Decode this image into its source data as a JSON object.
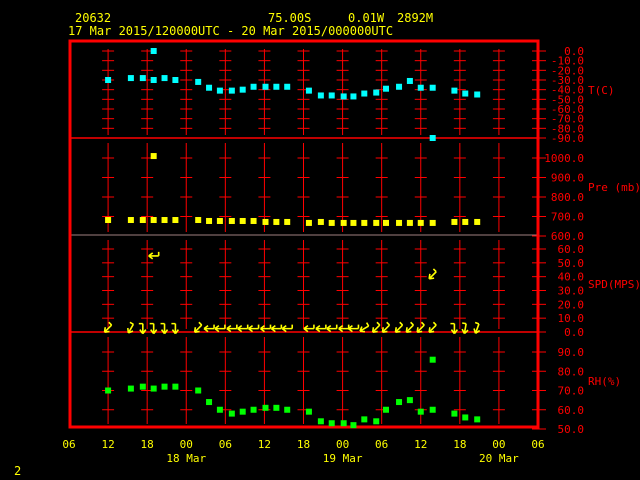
{
  "header": {
    "station_id": "20632",
    "latitude": "75.00S",
    "longitude": "0.01W",
    "elevation": "2892M",
    "period": "17 Mar 2015/120000UTC - 20 Mar 2015/000000UTC"
  },
  "page_number": "2",
  "colors": {
    "frame": "#ff0000",
    "text": "#ffff00",
    "temperature": "#00ffff",
    "pressure": "#ffff00",
    "wind": "#ffff00",
    "humidity": "#00ff00"
  },
  "chart_data": {
    "type": "scatter",
    "grid": true,
    "x_ticks": [
      {
        "time": "2015-03-17 06:00",
        "label": "06"
      },
      {
        "time": "2015-03-17 12:00",
        "label": "12"
      },
      {
        "time": "2015-03-17 18:00",
        "label": "18"
      },
      {
        "time": "2015-03-18 00:00",
        "label": "00"
      },
      {
        "time": "2015-03-18 06:00",
        "label": "06"
      },
      {
        "time": "2015-03-18 12:00",
        "label": "12"
      },
      {
        "time": "2015-03-18 18:00",
        "label": "18"
      },
      {
        "time": "2015-03-19 00:00",
        "label": "00"
      },
      {
        "time": "2015-03-19 06:00",
        "label": "06"
      },
      {
        "time": "2015-03-19 12:00",
        "label": "12"
      },
      {
        "time": "2015-03-19 18:00",
        "label": "18"
      },
      {
        "time": "2015-03-20 00:00",
        "label": "00"
      },
      {
        "time": "2015-03-20 06:00",
        "label": "06"
      }
    ],
    "date_labels": [
      {
        "time": "2015-03-18 00:00",
        "label": "18 Mar"
      },
      {
        "time": "2015-03-19 00:00",
        "label": "19 Mar"
      },
      {
        "time": "2015-03-20 00:00",
        "label": "20 Mar"
      }
    ],
    "xlim": [
      "2015-03-17 06:00",
      "2015-03-20 06:00"
    ],
    "times": [
      "2015-03-17 12:00",
      "2015-03-17 15:30",
      "2015-03-17 17:20",
      "2015-03-17 19:00",
      "2015-03-17 20:40",
      "2015-03-17 22:20",
      "2015-03-18 01:50",
      "2015-03-18 03:30",
      "2015-03-18 05:10",
      "2015-03-18 07:00",
      "2015-03-18 08:40",
      "2015-03-18 10:20",
      "2015-03-18 12:10",
      "2015-03-18 13:50",
      "2015-03-18 15:30",
      "2015-03-18 18:50",
      "2015-03-18 20:40",
      "2015-03-18 22:20",
      "2015-03-19 00:10",
      "2015-03-19 01:40",
      "2015-03-19 03:20",
      "2015-03-19 05:10",
      "2015-03-19 06:40",
      "2015-03-19 08:40",
      "2015-03-19 10:20",
      "2015-03-19 12:00",
      "2015-03-19 13:50",
      "2015-03-19 17:10",
      "2015-03-19 18:50",
      "2015-03-19 20:40"
    ],
    "panels": [
      {
        "key": "temperature",
        "label": "T(C)",
        "ylim": [
          -90,
          0
        ],
        "y_ticks": [
          "0.0",
          "-10.0",
          "-20.0",
          "-30.0",
          "-40.0",
          "-50.0",
          "-60.0",
          "-70.0",
          "-80.0",
          "-90.0"
        ],
        "y_tick_values": [
          0,
          -10,
          -20,
          -30,
          -40,
          -50,
          -60,
          -70,
          -80,
          -90
        ],
        "values": [
          -30,
          -28,
          -28,
          -30,
          -28,
          -30,
          -32,
          -38,
          -41,
          -41,
          -40,
          -37,
          -37,
          -37,
          -37,
          -41,
          -46,
          -46,
          -47,
          -47,
          -44,
          -43,
          -39,
          -37,
          -31,
          -38,
          -38,
          -41,
          -44,
          -45
        ],
        "extra_points": [
          {
            "time": "2015-03-17 19:00",
            "value": 0
          },
          {
            "time": "2015-03-19 13:50",
            "value": -90
          }
        ]
      },
      {
        "key": "pressure",
        "label": "Pre (mb)",
        "ylim": [
          600,
          1000
        ],
        "y_ticks": [
          "1000.0",
          "900.0",
          "800.0",
          "700.0",
          "600.0"
        ],
        "y_tick_values": [
          1000,
          900,
          800,
          700,
          600
        ],
        "values": [
          682,
          682,
          682,
          682,
          682,
          682,
          682,
          677,
          677,
          677,
          677,
          677,
          672,
          672,
          672,
          667,
          672,
          667,
          667,
          667,
          667,
          667,
          667,
          667,
          667,
          667,
          667,
          672,
          672,
          672
        ],
        "extra_points": [
          {
            "time": "2015-03-17 19:00",
            "value": 1010
          }
        ]
      },
      {
        "key": "wind",
        "label": "SPD(MPS)",
        "ylim": [
          0,
          60
        ],
        "y_ticks": [
          "60.0",
          "50.0",
          "40.0",
          "30.0",
          "20.0",
          "10.0",
          "0.0"
        ],
        "y_tick_values": [
          60,
          50,
          40,
          30,
          20,
          10,
          0
        ],
        "values": [
          1,
          1,
          1,
          1,
          1,
          1,
          1,
          1,
          1,
          1,
          1,
          1,
          1,
          1,
          1,
          1,
          1,
          1,
          1,
          1,
          1,
          1,
          1,
          1,
          1,
          1,
          1,
          1,
          1,
          1
        ],
        "direction_deg": [
          45,
          30,
          0,
          0,
          0,
          0,
          45,
          90,
          90,
          90,
          90,
          90,
          90,
          90,
          90,
          90,
          90,
          90,
          90,
          90,
          60,
          45,
          45,
          45,
          45,
          45,
          45,
          0,
          10,
          20
        ],
        "extra_points": [
          {
            "time": "2015-03-17 19:00",
            "value": 55,
            "direction_deg": 90
          },
          {
            "time": "2015-03-19 13:50",
            "value": 41,
            "direction_deg": 45
          }
        ]
      },
      {
        "key": "humidity",
        "label": "RH(%)",
        "ylim": [
          50,
          90
        ],
        "y_ticks": [
          "90.0",
          "80.0",
          "70.0",
          "60.0",
          "50.0"
        ],
        "y_tick_values": [
          90,
          80,
          70,
          60,
          50
        ],
        "values": [
          70,
          71,
          72,
          71,
          72,
          72,
          70,
          64,
          60,
          58,
          59,
          60,
          61,
          61,
          60,
          59,
          54,
          53,
          53,
          52,
          55,
          54,
          60,
          64,
          65,
          59,
          60,
          58,
          56,
          55
        ],
        "extra_points": [
          {
            "time": "2015-03-19 13:50",
            "value": 86
          }
        ]
      }
    ]
  }
}
